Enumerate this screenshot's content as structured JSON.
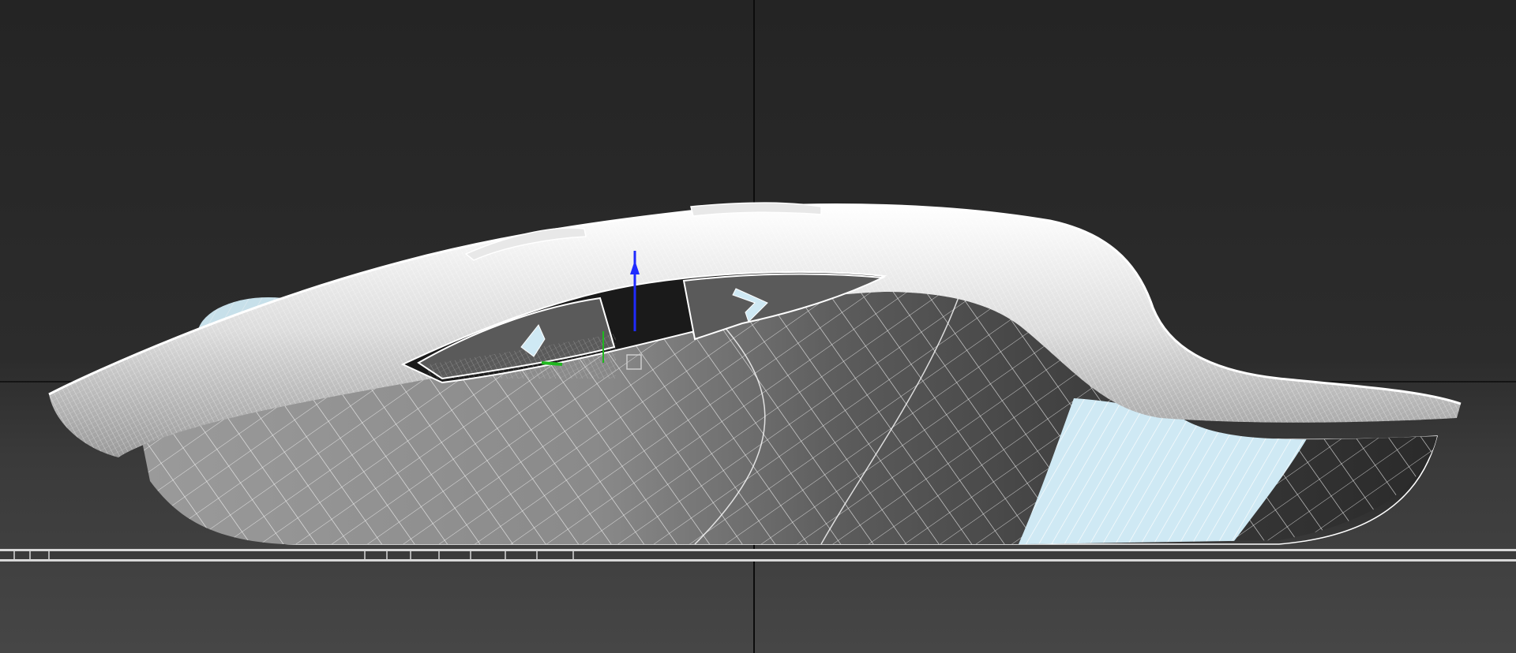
{
  "viewport": {
    "background_top": "#242424",
    "background_bottom": "#464646",
    "grid_axis_color": "#0c0c0c",
    "wire_color": "#ffffff",
    "shell_dark": "#2e2e2e",
    "shell_mid": "#7d7d7d",
    "selected_face_color": "#cfe9f4"
  },
  "model": {
    "icons": [
      "mouse-model",
      "side-button-forward-icon",
      "side-button-back-icon"
    ]
  },
  "gizmo": {
    "axes": [
      {
        "name": "z",
        "color": "#1f2bff"
      },
      {
        "name": "y",
        "color": "#1fb81f"
      }
    ]
  }
}
